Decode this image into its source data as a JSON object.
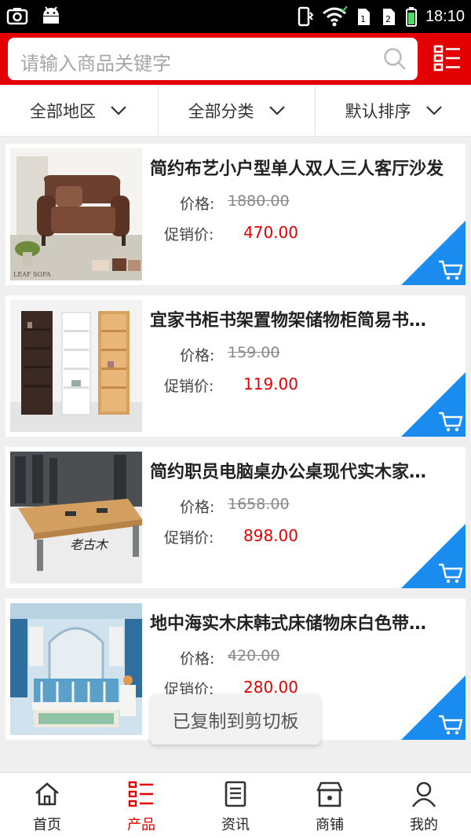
{
  "status_bar": {
    "time": "18:10"
  },
  "search": {
    "placeholder": "请输入商品关键字"
  },
  "filters": [
    "全部地区",
    "全部分类",
    "默认排序"
  ],
  "labels": {
    "price": "价格:",
    "promo": "促销价:"
  },
  "products": [
    {
      "title": "简约布艺小户型单人双人三人客厅沙发",
      "price": "1880.00",
      "promo_price": "470.00",
      "image_caption": "LEAF SOFA"
    },
    {
      "title": "宜家书柜书架置物架储物柜简易书…",
      "price": "159.00",
      "promo_price": "119.00"
    },
    {
      "title": "简约职员电脑桌办公桌现代实木家…",
      "price": "1658.00",
      "promo_price": "898.00",
      "image_caption": "老古木"
    },
    {
      "title": "地中海实木床韩式床储物床白色带…",
      "price": "420.00",
      "promo_price": "280.00"
    }
  ],
  "toast": "已复制到剪切板",
  "bottom_nav": [
    {
      "label": "首页",
      "icon": "home-icon"
    },
    {
      "label": "产品",
      "icon": "product-list-icon",
      "active": true
    },
    {
      "label": "资讯",
      "icon": "news-icon"
    },
    {
      "label": "商铺",
      "icon": "store-icon"
    },
    {
      "label": "我的",
      "icon": "user-icon"
    }
  ],
  "colors": {
    "brand": "#e30000",
    "cart_corner": "#1a8cf0",
    "promo": "#e30000"
  }
}
